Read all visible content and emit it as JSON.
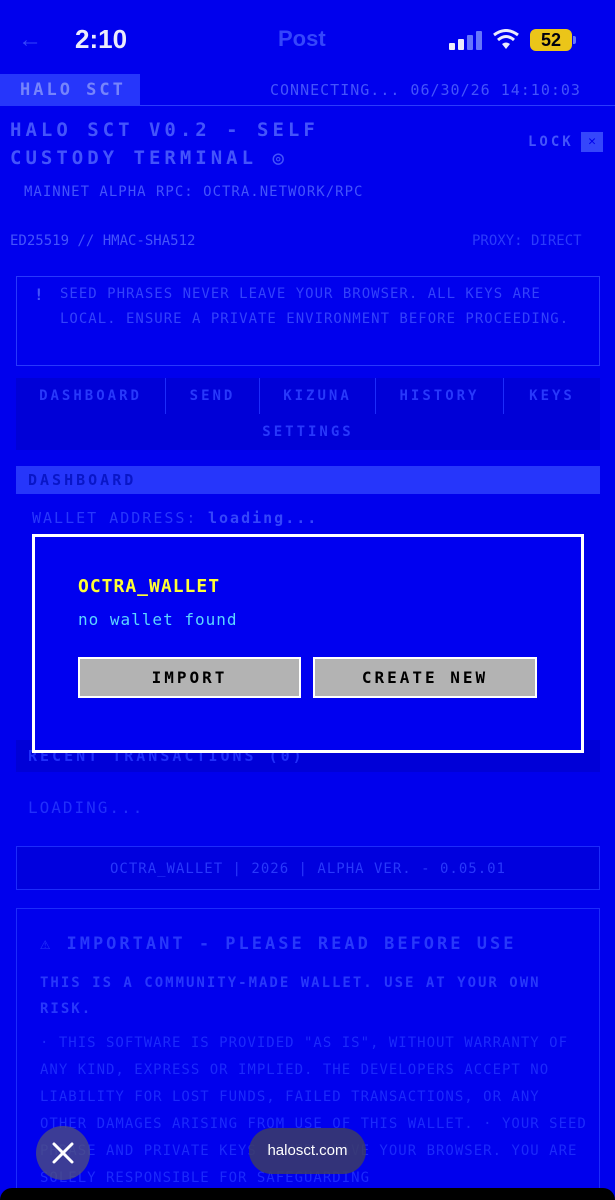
{
  "status": {
    "time": "2:10",
    "battery": "52",
    "ghost_title": "Post"
  },
  "header": {
    "brand": "HALO SCT",
    "connection": "CONNECTING... 06/30/26 14:10:03",
    "title": "HALO SCT V0.2 - SELF CUSTODY TERMINAL ◎",
    "lock_label": "LOCK",
    "lock_close": "✕",
    "network": "MAINNET ALPHA   RPC: OCTRA.NETWORK/RPC",
    "algo": "ED25519 // HMAC-SHA512",
    "proxy": "PROXY: DIRECT"
  },
  "warning": {
    "mark": "!",
    "text": "SEED PHRASES NEVER LEAVE YOUR BROWSER. ALL KEYS ARE LOCAL. ENSURE A PRIVATE ENVIRONMENT BEFORE PROCEEDING."
  },
  "tabs": [
    "DASHBOARD",
    "SEND",
    "KIZUNA",
    "HISTORY",
    "KEYS"
  ],
  "tab_settings": "SETTINGS",
  "dashboard": {
    "heading": "DASHBOARD",
    "address_label": "WALLET ADDRESS:",
    "address_value": "loading...",
    "recent": "RECENT TRANSACTIONS (0)",
    "loading": "LOADING..."
  },
  "footer": "OCTRA_WALLET | 2026 | ALPHA VER. - 0.05.01",
  "important": {
    "title": "⚠ IMPORTANT - PLEASE READ BEFORE USE",
    "subtitle": "THIS IS A COMMUNITY-MADE WALLET. USE AT YOUR OWN RISK.",
    "body": "· THIS SOFTWARE IS PROVIDED \"AS IS\", WITHOUT WARRANTY OF ANY KIND, EXPRESS OR IMPLIED. THE DEVELOPERS ACCEPT NO LIABILITY FOR LOST FUNDS, FAILED TRANSACTIONS, OR ANY OTHER DAMAGES ARISING FROM USE OF THIS WALLET. · YOUR SEED PHRASE AND PRIVATE KEYS NEVER LEAVE YOUR BROWSER. YOU ARE SOLELY RESPONSIBLE FOR SAFEGUARDING"
  },
  "modal": {
    "title": "OCTRA_WALLET",
    "subtitle": "no wallet found",
    "import_label": "IMPORT",
    "create_label": "CREATE NEW"
  },
  "browser": {
    "url": "halosct.com",
    "close": "✕"
  },
  "colors": {
    "background": "#0000f0",
    "modal_title": "#ffff33",
    "modal_subtitle": "#5cd6ff",
    "button_bg": "#b3b3b3"
  }
}
